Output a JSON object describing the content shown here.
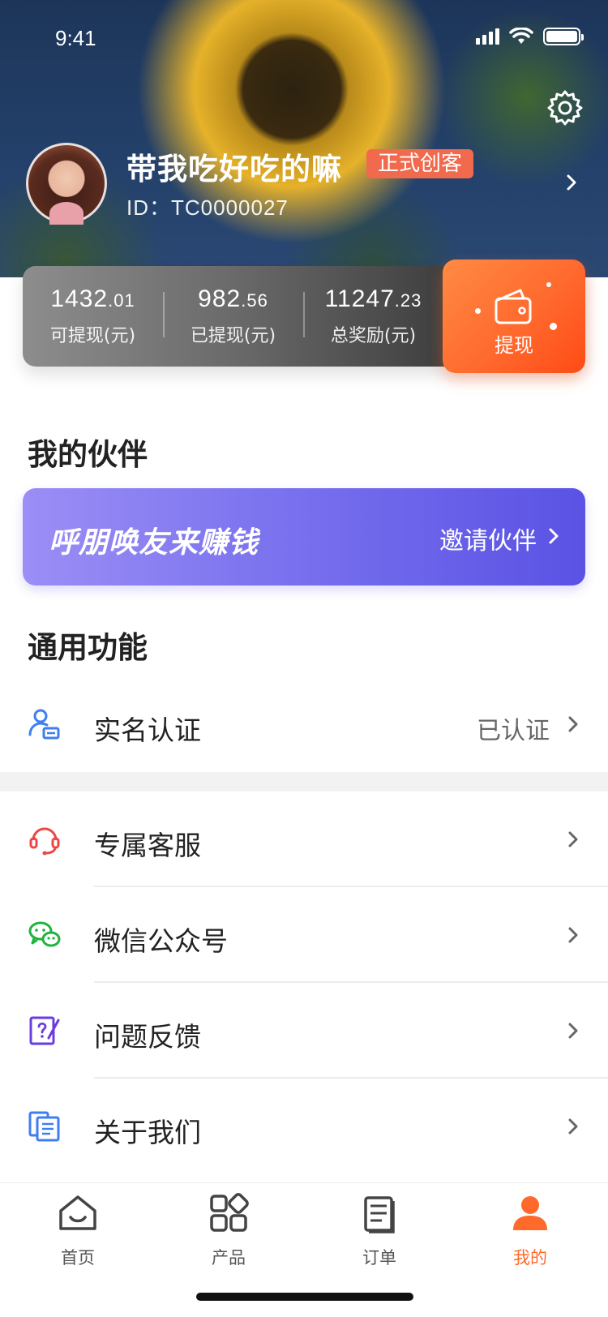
{
  "status_bar": {
    "time": "9:41"
  },
  "profile": {
    "name": "带我吃好吃的嘛",
    "badge": "正式创客",
    "id_text": "ID：TC0000027"
  },
  "earnings": {
    "items": [
      {
        "value_int": "1432",
        "value_dec": ".01",
        "label": "可提现(元)"
      },
      {
        "value_int": "982",
        "value_dec": ".56",
        "label": "已提现(元)"
      },
      {
        "value_int": "11247",
        "value_dec": ".23",
        "label": "总奖励(元)"
      }
    ],
    "withdraw_label": "提现"
  },
  "partners": {
    "title": "我的伙伴",
    "banner_slogan": "呼朋唤友来赚钱",
    "banner_action": "邀请伙伴"
  },
  "general": {
    "title": "通用功能",
    "items": [
      {
        "label": "实名认证",
        "value": "已认证",
        "icon": "id-verify-icon"
      },
      {
        "label": "专属客服",
        "value": "",
        "icon": "headset-icon"
      },
      {
        "label": "微信公众号",
        "value": "",
        "icon": "wechat-icon"
      },
      {
        "label": "问题反馈",
        "value": "",
        "icon": "feedback-icon"
      },
      {
        "label": "关于我们",
        "value": "",
        "icon": "about-icon"
      }
    ]
  },
  "tab_bar": {
    "tabs": [
      {
        "label": "首页",
        "icon": "home-icon",
        "active": false
      },
      {
        "label": "产品",
        "icon": "products-icon",
        "active": false
      },
      {
        "label": "订单",
        "icon": "orders-icon",
        "active": false
      },
      {
        "label": "我的",
        "icon": "profile-icon",
        "active": true
      }
    ]
  },
  "colors": {
    "accent": "#ff6a2b",
    "badge": "#f16a4d",
    "invite_start": "#9c8ef6",
    "invite_end": "#5a52e4"
  }
}
